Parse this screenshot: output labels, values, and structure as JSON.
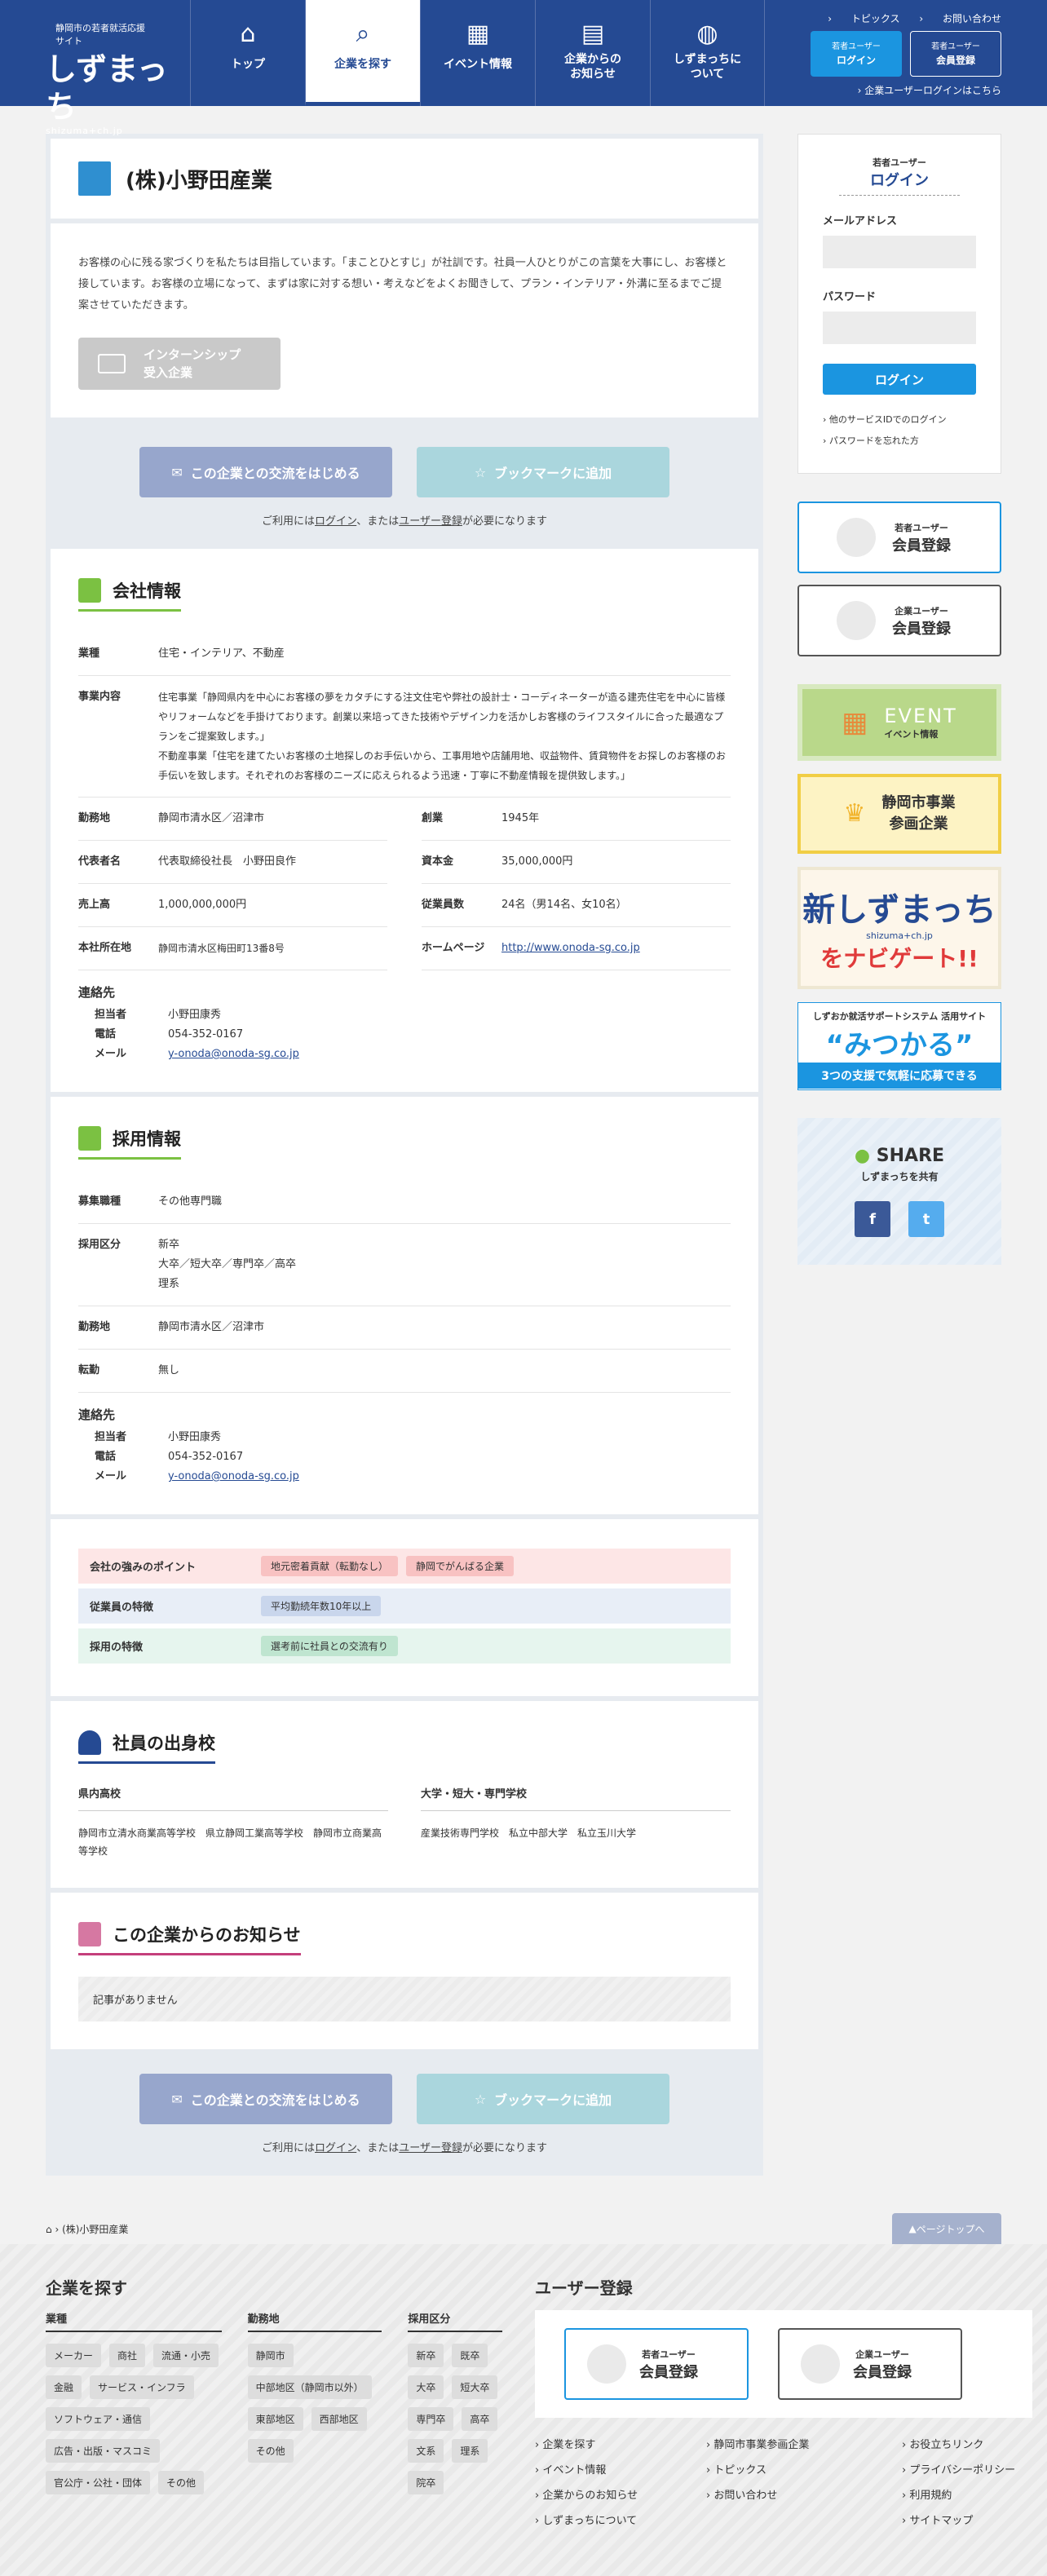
{
  "header": {
    "site_tag": "静岡市の若者就活応援サイト",
    "logo": "しずまっち",
    "logo_url": "shizuma+ch.jp",
    "nav": [
      {
        "label": "トップ",
        "icon": "home-icon"
      },
      {
        "label": "企業を探す",
        "icon": "search-icon"
      },
      {
        "label": "イベント情報",
        "icon": "calendar-icon"
      },
      {
        "label": "企業からの\nお知らせ",
        "icon": "news-icon"
      },
      {
        "label": "しずまっちに\nついて",
        "icon": "globe-icon"
      }
    ],
    "toplinks": [
      "トピックス",
      "お問い合わせ"
    ],
    "young_login": {
      "sub": "若者ユーザー",
      "main": "ログイン"
    },
    "young_register": {
      "sub": "若者ユーザー",
      "main": "会員登録"
    },
    "corp_login": "企業ユーザーログインはこちら"
  },
  "company": {
    "name": "(株)小野田産業",
    "intro": "お客様の心に残る家づくりを私たちは目指しています。「まことひとすじ」が社訓です。社員一人ひとりがこの言葉を大事にし、お客様と接しています。お客様の立場になって、まずは家に対する想い・考えなどをよくお聞きして、プラン・インテリア・外溝に至るまでご提案させていただきます。",
    "badge": "インターンシップ\n受入企業"
  },
  "actions": {
    "exchange": "この企業との交流をはじめる",
    "bookmark": "ブックマークに追加",
    "note_pre": "ご利用には",
    "note_login": "ログイン",
    "note_mid": "、または",
    "note_reg": "ユーザー登録",
    "note_post": "が必要になります"
  },
  "info": {
    "title": "会社情報",
    "industry_k": "業種",
    "industry": "住宅・インテリア、不動産",
    "business_k": "事業内容",
    "business": "住宅事業「静岡県内を中心にお客様の夢をカタチにする注文住宅や弊社の設計士・コーディネーターが造る建売住宅を中心に皆様やリフォームなどを手掛けております。創業以来培ってきた技術やデザイン力を活かしお客様のライフスタイルに合った最適なプランをご提案致します。」\n不動産事業「住宅を建てたいお客様の土地探しのお手伝いから、工事用地や店舗用地、収益物件、賃貸物件をお探しのお客様のお手伝いを致します。それぞれのお客様のニーズに応えられるよう迅速・丁寧に不動産情報を提供致します。」",
    "location_k": "勤務地",
    "location": "静岡市清水区／沼津市",
    "founded_k": "創業",
    "founded": "1945年",
    "rep_k": "代表者名",
    "rep": "代表取締役社長　小野田良作",
    "capital_k": "資本金",
    "capital": "35,000,000円",
    "sales_k": "売上高",
    "sales": "1,000,000,000円",
    "employees_k": "従業員数",
    "employees": "24名（男14名、女10名）",
    "hq_k": "本社所在地",
    "hq": "静岡市清水区梅田町13番8号",
    "hp_k": "ホームページ",
    "hp": "http://www.onoda-sg.co.jp",
    "contact_title": "連絡先",
    "person_k": "担当者",
    "person": "小野田康秀",
    "tel_k": "電話",
    "tel": "054-352-0167",
    "mail_k": "メール",
    "mail": "y-onoda@onoda-sg.co.jp"
  },
  "recruit": {
    "title": "採用情報",
    "job_k": "募集職種",
    "job": "その他専門職",
    "type_k": "採用区分",
    "type": "新卒\n大卒／短大卒／専門卒／高卒\n理系",
    "loc_k": "勤務地",
    "loc": "静岡市清水区／沼津市",
    "transfer_k": "転勤",
    "transfer": "無し",
    "contact_title": "連絡先",
    "person_k": "担当者",
    "person": "小野田康秀",
    "tel_k": "電話",
    "tel": "054-352-0167",
    "mail_k": "メール",
    "mail": "y-onoda@onoda-sg.co.jp"
  },
  "features": [
    {
      "k": "会社の強みのポイント",
      "tags": [
        "地元密着貢献（転勤なし）",
        "静岡でがんばる企業"
      ]
    },
    {
      "k": "従業員の特徴",
      "tags": [
        "平均勤続年数10年以上"
      ]
    },
    {
      "k": "採用の特徴",
      "tags": [
        "選考前に社員との交流有り"
      ]
    }
  ],
  "schools": {
    "title": "社員の出身校",
    "pref_k": "県内高校",
    "pref": "静岡市立清水商業高等学校　県立静岡工業高等学校　静岡市立商業高等学校",
    "univ_k": "大学・短大・専門学校",
    "univ": "産業技術専門学校　私立中部大学　私立玉川大学"
  },
  "news": {
    "title": "この企業からのお知らせ",
    "empty": "記事がありません"
  },
  "side": {
    "login_sub": "若者ユーザー",
    "login_main": "ログイン",
    "email_label": "メールアドレス",
    "pass_label": "パスワード",
    "login_btn": "ログイン",
    "other": "他のサービスIDでのログイン",
    "forgot": "パスワードを忘れた方",
    "reg_young_sub": "若者ユーザー",
    "reg_young": "会員登録",
    "reg_corp_sub": "企業ユーザー",
    "reg_corp": "会員登録",
    "event1": "EVENT",
    "event2": "イベント情報",
    "sanka": "静岡市事業\n参画企業",
    "navi1": "新しずまっち",
    "navi_url": "shizuma+ch.jp",
    "navi2": "をナビゲート!!",
    "mk1": "しずおか就活サポートシステム 活用サイト",
    "mk2": "“みつかる”",
    "mk3": "3つの支援で気軽に応募できる",
    "share": "SHARE",
    "share_sub": "しずまっちを共有",
    "fb": "f",
    "tw": "t"
  },
  "breadcrumb": {
    "current": "(株)小野田産業",
    "pagetop": "ページトップへ"
  },
  "footer": {
    "search_title": "企業を探す",
    "ind_k": "業種",
    "ind": [
      "メーカー",
      "商社",
      "流通・小売",
      "金融",
      "サービス・インフラ",
      "ソフトウェア・通信",
      "広告・出版・マスコミ",
      "官公庁・公社・団体",
      "その他"
    ],
    "loc_k": "勤務地",
    "loc": [
      "静岡市",
      "中部地区（静岡市以外）",
      "東部地区",
      "西部地区",
      "その他"
    ],
    "cat_k": "採用区分",
    "cat": [
      "新卒",
      "既卒",
      "大卒",
      "短大卒",
      "専門卒",
      "高卒",
      "文系",
      "理系",
      "院卒"
    ],
    "reg_title": "ユーザー登録",
    "links": [
      "企業を探す",
      "静岡市事業参画企業",
      "お役立ちリンク",
      "イベント情報",
      "トピックス",
      "プライバシーポリシー",
      "企業からのお知らせ",
      "お問い合わせ",
      "利用規約",
      "しずまっちについて",
      "",
      "サイトマップ"
    ]
  },
  "colors": {
    "primary": "#254a93",
    "accent": "#1b95e0"
  }
}
